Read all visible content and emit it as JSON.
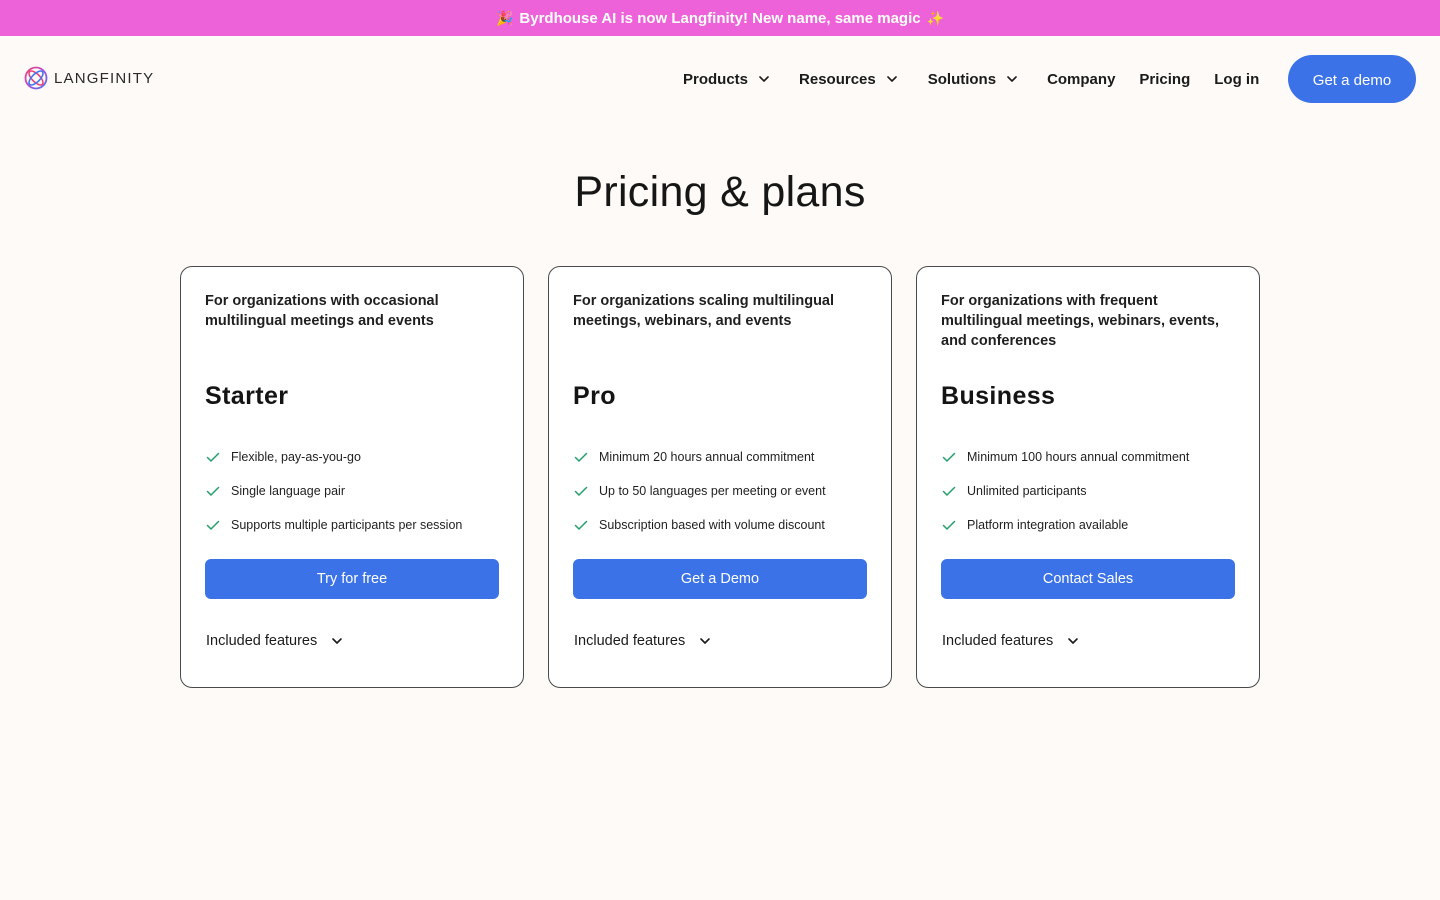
{
  "banner": {
    "left_glyph": "🎉",
    "text": "Byrdhouse AI is now Langfinity! New name, same magic",
    "right_glyph": "✨",
    "color": "#ed62d9"
  },
  "header": {
    "logo_text": "LANGFINITY",
    "nav": {
      "products": "Products",
      "resources": "Resources",
      "solutions": "Solutions",
      "company": "Company",
      "pricing": "Pricing",
      "login": "Log in"
    },
    "cta": "Get a demo"
  },
  "page": {
    "title": "Pricing & plans"
  },
  "colors": {
    "accent": "#3b72e8",
    "check": "#22a06b",
    "background": "#fdfaf7"
  },
  "plans": [
    {
      "description": "For organizations with occasional multilingual meetings and events",
      "name": "Starter",
      "features": [
        "Flexible, pay-as-you-go",
        "Single language pair",
        "Supports multiple participants per session"
      ],
      "button": "Try for free",
      "included_label": "Included features"
    },
    {
      "description": "For organizations scaling multilingual meetings, webinars, and events",
      "name": "Pro",
      "features": [
        "Minimum 20 hours annual commitment",
        "Up to 50 languages per meeting or event",
        "Subscription based with volume discount"
      ],
      "button": "Get a Demo",
      "included_label": "Included features"
    },
    {
      "description": "For organizations with frequent multilingual meetings, webinars, events, and conferences",
      "name": "Business",
      "features": [
        "Minimum 100 hours annual commitment",
        "Unlimited participants",
        "Platform integration available"
      ],
      "button": "Contact Sales",
      "included_label": "Included features"
    }
  ],
  "icons": {
    "logo": "langfinity-logo-icon",
    "dropdown": "chevron-down-icon",
    "feature": "check-icon"
  }
}
